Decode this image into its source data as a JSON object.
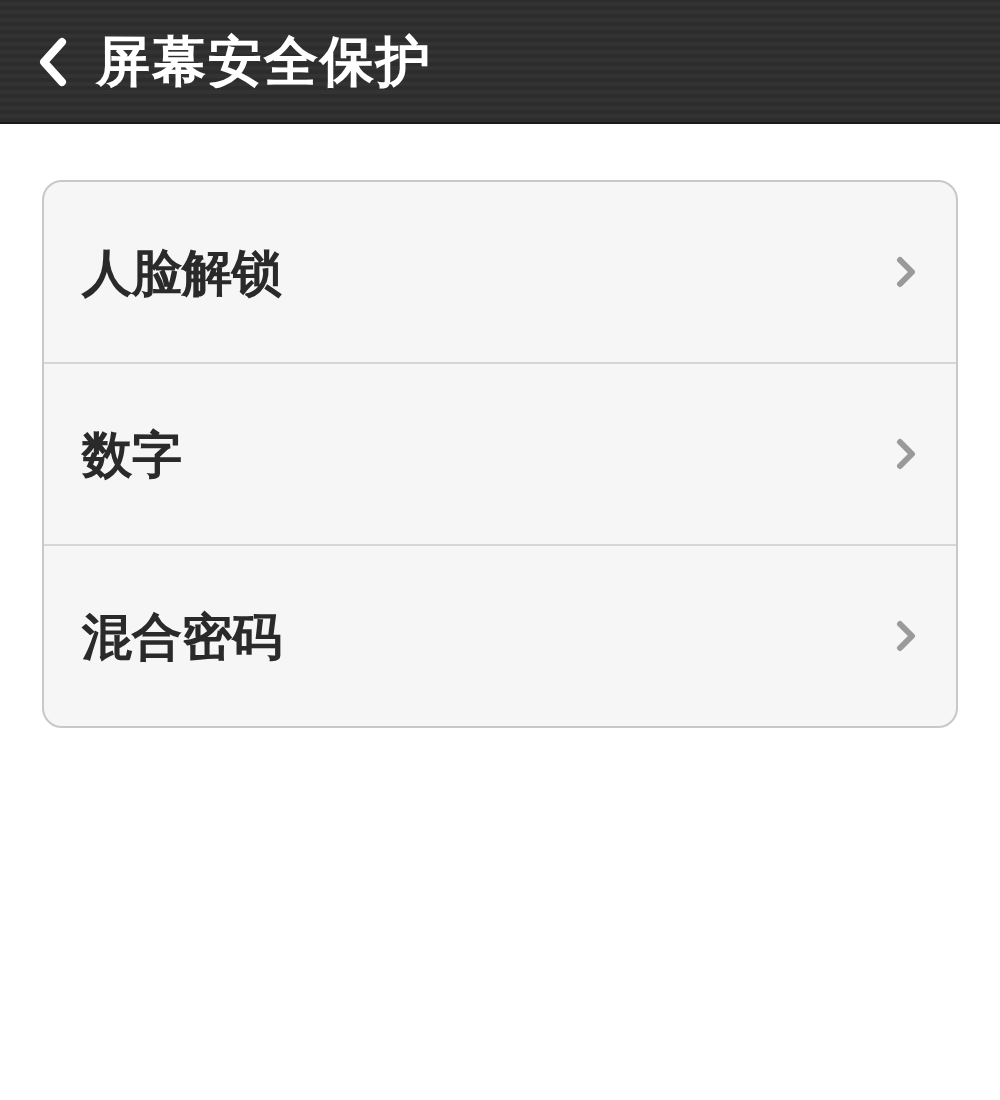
{
  "header": {
    "title": "屏幕安全保护"
  },
  "items": [
    {
      "label": "人脸解锁"
    },
    {
      "label": "数字"
    },
    {
      "label": "混合密码"
    }
  ]
}
